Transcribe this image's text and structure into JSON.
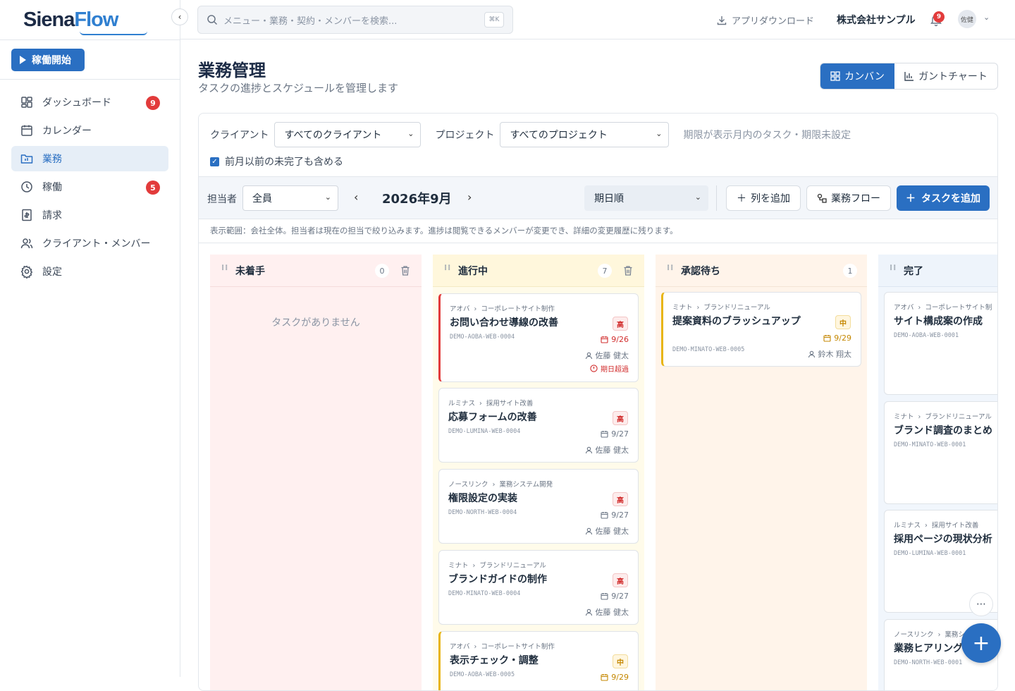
{
  "brand": {
    "name_a": "Siena",
    "name_b": "Flow"
  },
  "sidebar": {
    "start_button": "稼働開始",
    "items": [
      {
        "label": "ダッシュボード",
        "badge": "9",
        "icon": "dashboard-icon"
      },
      {
        "label": "カレンダー",
        "badge": "",
        "icon": "calendar-icon"
      },
      {
        "label": "業務",
        "badge": "",
        "icon": "folder-icon",
        "active": true
      },
      {
        "label": "稼働",
        "badge": "5",
        "icon": "clock-icon"
      },
      {
        "label": "請求",
        "badge": "",
        "icon": "invoice-icon"
      },
      {
        "label": "クライアント・メンバー",
        "badge": "",
        "icon": "users-icon"
      },
      {
        "label": "設定",
        "badge": "",
        "icon": "gear-icon"
      }
    ]
  },
  "topbar": {
    "search_placeholder": "メニュー・業務・契約・メンバーを検索...",
    "shortcut": "⌘K",
    "download": "アプリダウンロード",
    "company": "株式会社サンプル",
    "notification_count": "9",
    "avatar_text": "佐健"
  },
  "page": {
    "title": "業務管理",
    "subtitle": "タスクの進捗とスケジュールを管理します",
    "view_kanban": "カンバン",
    "view_gantt": "ガントチャート"
  },
  "filters": {
    "client_label": "クライアント",
    "client_value": "すべてのクライアント",
    "project_label": "プロジェクト",
    "project_value": "すべてのプロジェクト",
    "hint": "期限が表示月内のタスク・期限未設定",
    "include_prev": "前月以前の未完了も含める"
  },
  "toolbar": {
    "assignee_label": "担当者",
    "assignee_value": "全員",
    "month": "2026年9月",
    "sort_value": "期日順",
    "add_column": "列を追加",
    "workflow": "業務フロー",
    "add_task": "タスクを追加"
  },
  "scope_note": "表示範囲：会社全体。担当者は現在の担当で絞り込みます。進捗は閲覧できるメンバーが変更でき、詳細の変更履歴に残ります。",
  "colors": {
    "accent": "#2a6fc2",
    "danger": "#e23b3b",
    "warning": "#e8b512"
  },
  "columns": [
    {
      "name": "未着手",
      "count": "0",
      "empty_text": "タスクがありません",
      "has_trash": true,
      "cards": []
    },
    {
      "name": "進行中",
      "count": "7",
      "has_trash": true,
      "cards": [
        {
          "client": "アオバ",
          "project": "コーポレートサイト制作",
          "title": "お問い合わせ導線の改善",
          "id": "DEMO-AOBA-WEB-0004",
          "priority": "高",
          "due": "9/26",
          "assignee": "佐藤 健太",
          "overdue": "期日超過"
        },
        {
          "client": "ルミナス",
          "project": "採用サイト改善",
          "title": "応募フォームの改善",
          "id": "DEMO-LUMINA-WEB-0004",
          "priority": "高",
          "due": "9/27",
          "assignee": "佐藤 健太"
        },
        {
          "client": "ノースリンク",
          "project": "業務システム開発",
          "title": "権限設定の実装",
          "id": "DEMO-NORTH-WEB-0004",
          "priority": "高",
          "due": "9/27",
          "assignee": "佐藤 健太"
        },
        {
          "client": "ミナト",
          "project": "ブランドリニューアル",
          "title": "ブランドガイドの制作",
          "id": "DEMO-MINATO-WEB-0004",
          "priority": "高",
          "due": "9/27",
          "assignee": "佐藤 健太"
        },
        {
          "client": "アオバ",
          "project": "コーポレートサイト制作",
          "title": "表示チェック・調整",
          "id": "DEMO-AOBA-WEB-0005",
          "priority": "中",
          "due": "9/29"
        }
      ]
    },
    {
      "name": "承認待ち",
      "count": "1",
      "cards": [
        {
          "client": "ミナト",
          "project": "ブランドリニューアル",
          "title": "提案資料のブラッシュアップ",
          "id": "DEMO-MINATO-WEB-0005",
          "priority": "中",
          "due": "9/29",
          "assignee": "鈴木 翔太"
        }
      ]
    },
    {
      "name": "完了",
      "cards": [
        {
          "client": "アオバ",
          "project": "コーポレートサイト制",
          "title": "サイト構成案の作成",
          "id": "DEMO-AOBA-WEB-0001"
        },
        {
          "client": "ミナト",
          "project": "ブランドリニューアル",
          "title": "ブランド調査のまとめ",
          "id": "DEMO-MINATO-WEB-0001"
        },
        {
          "client": "ルミナス",
          "project": "採用サイト改善",
          "title": "採用ページの現状分析",
          "id": "DEMO-LUMINA-WEB-0001"
        },
        {
          "client": "ノースリンク",
          "project": "業務シ",
          "title": "業務ヒアリング",
          "id": "DEMO-NORTH-WEB-0001"
        }
      ]
    }
  ]
}
